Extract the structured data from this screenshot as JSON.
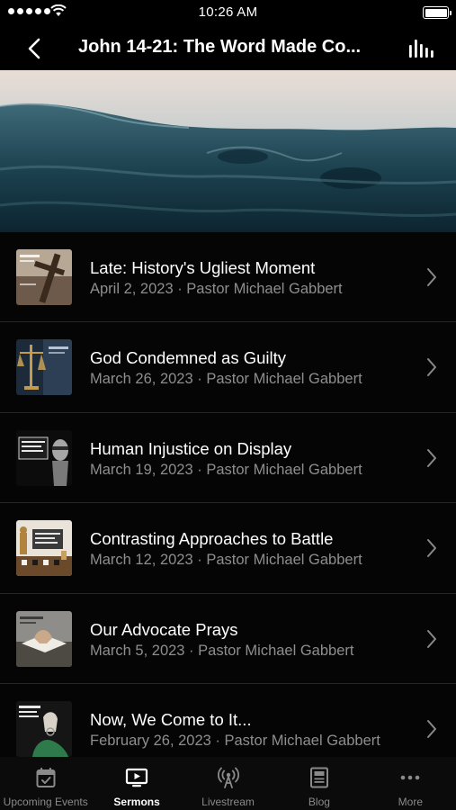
{
  "status": {
    "time": "10:26 AM"
  },
  "nav": {
    "title": "John 14-21: The Word Made Co..."
  },
  "sermons": [
    {
      "title": "Late: History's Ugliest Moment",
      "meta": "April 2, 2023 · Pastor Michael Gabbert",
      "thumb": "cross-artwork"
    },
    {
      "title": "God Condemned as Guilty",
      "meta": "March 26, 2023 · Pastor Michael Gabbert",
      "thumb": "scales-of-justice"
    },
    {
      "title": "Human Injustice on Display",
      "meta": "March 19, 2023 · Pastor Michael Gabbert",
      "thumb": "blindfold-justice"
    },
    {
      "title": "Contrasting Approaches to Battle",
      "meta": "March 12, 2023 · Pastor Michael Gabbert",
      "thumb": "chess-pieces"
    },
    {
      "title": "Our Advocate Prays",
      "meta": "March 5, 2023 · Pastor Michael Gabbert",
      "thumb": "praying-hands"
    },
    {
      "title": "Now, We Come to It...",
      "meta": "February 26, 2023 · Pastor Michael Gabbert",
      "thumb": "hands-in-chains"
    }
  ],
  "tabs": [
    {
      "label": "Upcoming Events",
      "icon": "calendar-icon",
      "active": false
    },
    {
      "label": "Sermons",
      "icon": "tv-play-icon",
      "active": true
    },
    {
      "label": "Livestream",
      "icon": "broadcast-icon",
      "active": false
    },
    {
      "label": "Blog",
      "icon": "newspaper-icon",
      "active": false
    },
    {
      "label": "More",
      "icon": "more-dots-icon",
      "active": false
    }
  ],
  "colors": {
    "background": "#000000",
    "secondary_text": "#8e8e8e",
    "tab_inactive": "#8a8a8a",
    "tab_active": "#ffffff"
  }
}
